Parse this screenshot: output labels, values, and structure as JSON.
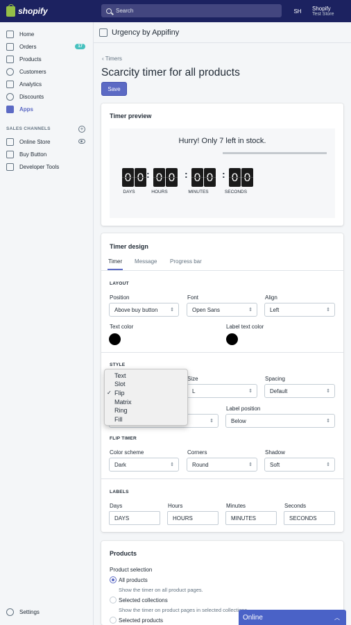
{
  "topbar": {
    "logo_text": "shopify",
    "search_placeholder": "Search",
    "initials": "SH",
    "account_name": "Shopify",
    "store_name": "Test Store"
  },
  "sidebar": {
    "items": [
      {
        "label": "Home",
        "icon": "home-icon"
      },
      {
        "label": "Orders",
        "icon": "orders-icon",
        "badge": "17"
      },
      {
        "label": "Products",
        "icon": "tag-icon"
      },
      {
        "label": "Customers",
        "icon": "person-icon"
      },
      {
        "label": "Analytics",
        "icon": "chart-icon"
      },
      {
        "label": "Discounts",
        "icon": "discount-icon"
      },
      {
        "label": "Apps",
        "icon": "apps-icon",
        "active": true
      }
    ],
    "channels_heading": "SALES CHANNELS",
    "channels": [
      {
        "label": "Online Store",
        "icon": "store-icon"
      },
      {
        "label": "Buy Button",
        "icon": "buy-button-icon"
      },
      {
        "label": "Developer Tools",
        "icon": "developer-icon"
      }
    ],
    "settings_label": "Settings"
  },
  "app": {
    "title": "Urgency by Appifiny"
  },
  "page": {
    "breadcrumb": "Timers",
    "title": "Scarcity timer for all products",
    "save_label": "Save"
  },
  "preview": {
    "heading": "Timer preview",
    "message": "Hurry! Only 7 left in stock.",
    "digits": [
      "0",
      "0",
      "0",
      "0",
      "0",
      "0",
      "0",
      "0"
    ],
    "labels": [
      "DAYS",
      "HOURS",
      "MINUTES",
      "SECONDS"
    ]
  },
  "design": {
    "heading": "Timer design",
    "tabs": [
      "Timer",
      "Message",
      "Progress bar"
    ],
    "layout": {
      "heading": "LAYOUT",
      "position_label": "Position",
      "position_value": "Above buy button",
      "font_label": "Font",
      "font_value": "Open Sans",
      "align_label": "Align",
      "align_value": "Left",
      "text_color_label": "Text color",
      "label_text_color_label": "Label text color",
      "text_color": "#000000",
      "label_text_color": "#000000"
    },
    "style": {
      "heading": "STYLE",
      "size_label": "Size",
      "size_value": "L",
      "spacing_label": "Spacing",
      "spacing_value": "Default",
      "label_position_label": "Label position",
      "label_position_value": "Below"
    },
    "style_menu": {
      "options": [
        "Text",
        "Slot",
        "Flip",
        "Matrix",
        "Ring",
        "Fill"
      ],
      "selected": "Flip"
    },
    "flip": {
      "heading": "FLIP TIMER",
      "scheme_label": "Color scheme",
      "scheme_value": "Dark",
      "corners_label": "Corners",
      "corners_value": "Round",
      "shadow_label": "Shadow",
      "shadow_value": "Soft"
    },
    "labels": {
      "heading": "LABELS",
      "fields": [
        {
          "label": "Days",
          "value": "DAYS"
        },
        {
          "label": "Hours",
          "value": "HOURS"
        },
        {
          "label": "Minutes",
          "value": "MINUTES"
        },
        {
          "label": "Seconds",
          "value": "SECONDS"
        }
      ]
    }
  },
  "products": {
    "heading": "Products",
    "selection_label": "Product selection",
    "options": [
      {
        "label": "All products",
        "help": "Show the timer on all product pages.",
        "selected": true
      },
      {
        "label": "Selected collections",
        "help": "Show the timer on product pages in selected collections."
      },
      {
        "label": "Selected products"
      }
    ]
  },
  "chat": {
    "label": "Online"
  }
}
